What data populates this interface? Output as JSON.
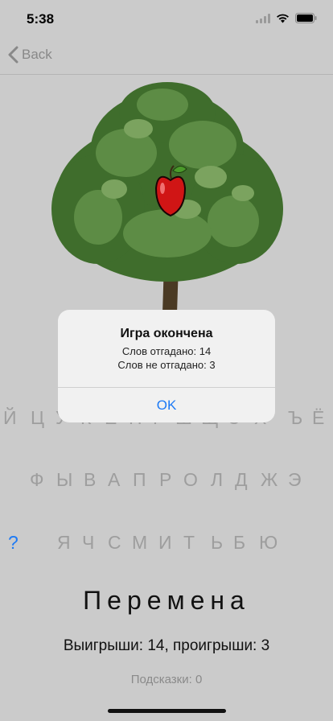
{
  "status_bar": {
    "time": "5:38"
  },
  "nav": {
    "back_label": "Back"
  },
  "keyboard": {
    "row1": [
      "Й",
      "Ц",
      "У",
      "К",
      "Е",
      "Н",
      "Г",
      "Ш",
      "Щ",
      "З",
      "Х",
      "Ъ",
      "Ё"
    ],
    "row2": [
      "Ф",
      "Ы",
      "В",
      "А",
      "П",
      "Р",
      "О",
      "Л",
      "Д",
      "Ж",
      "Э"
    ],
    "row3": [
      "Я",
      "Ч",
      "С",
      "М",
      "И",
      "Т",
      "Ь",
      "Б",
      "Ю"
    ],
    "hint_label": "?"
  },
  "game": {
    "word": "Перемена",
    "score": "Выигрыши: 14, проигрыши: 3",
    "hints": "Подсказки: 0"
  },
  "alert": {
    "title": "Игра окончена",
    "line1": "Слов отгадано: 14",
    "line2": "Слов не отгадано: 3",
    "ok_label": "OK"
  },
  "colors": {
    "accent": "#1d7af5",
    "background": "#cbcbcb",
    "key_text": "#9e9e9e"
  }
}
